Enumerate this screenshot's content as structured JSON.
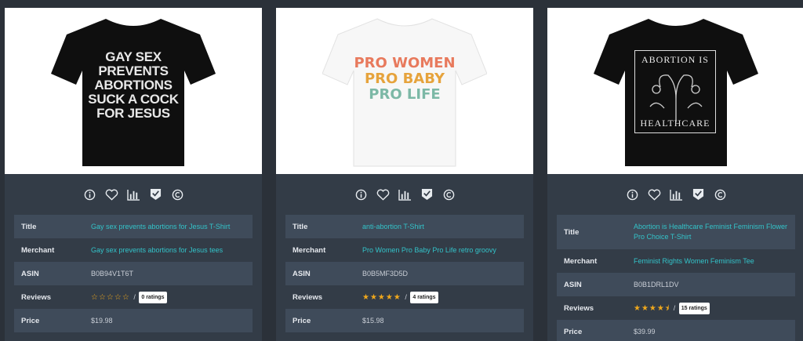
{
  "cards": [
    {
      "shirt_color": "#0f0f0f",
      "print_lines": [
        "GAY SEX",
        "PREVENTS",
        "ABORTIONS",
        "SUCK A COCK",
        "FOR JESUS"
      ],
      "fields": {
        "title_label": "Title",
        "title": "Gay sex prevents abortions for Jesus T-Shirt",
        "merchant_label": "Merchant",
        "merchant": "Gay sex prevents abortions for Jesus tees",
        "asin_label": "ASIN",
        "asin": "B0B94V1T6T",
        "reviews_label": "Reviews",
        "stars": "☆☆☆☆☆",
        "ratings": "0 ratings",
        "price_label": "Price",
        "price": "$19.98"
      }
    },
    {
      "shirt_color": "#ffffff",
      "print_lines": [
        "PRO WOMEN",
        "PRO BABY",
        "PRO LIFE"
      ],
      "fields": {
        "title_label": "Title",
        "title": "anti-abortion T-Shirt",
        "merchant_label": "Merchant",
        "merchant": "Pro Women Pro Baby Pro Life retro groovy",
        "asin_label": "ASIN",
        "asin": "B0B5MF3D5D",
        "reviews_label": "Reviews",
        "stars": "★★★★★",
        "ratings": "4 ratings",
        "price_label": "Price",
        "price": "$15.98"
      }
    },
    {
      "shirt_color": "#0f0f0f",
      "print_lines": [
        "ABORTION IS",
        "HEALTHCARE"
      ],
      "fields": {
        "title_label": "Title",
        "title": "Abortion is Healthcare Feminist Feminism Flower Pro Choice T-Shirt",
        "merchant_label": "Merchant",
        "merchant": "Feminist Rights Women Feminism Tee",
        "asin_label": "ASIN",
        "asin": "B0B1DRL1DV",
        "reviews_label": "Reviews",
        "stars": "★★★★⯨",
        "ratings": "15 ratings",
        "price_label": "Price",
        "price": "$39.99"
      }
    }
  ],
  "icons": [
    "info-icon",
    "heart-icon",
    "chart-icon",
    "check-badge-icon",
    "copyright-icon"
  ],
  "colors": {
    "link": "#33c3c9",
    "star": "#f0a81c",
    "row": "#3f4b5a",
    "card": "#333c47",
    "bg": "#2b3139"
  },
  "separator": "/"
}
